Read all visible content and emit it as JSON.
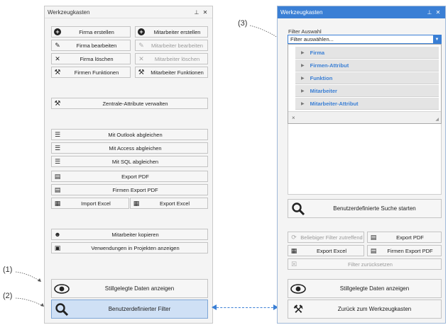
{
  "left_panel": {
    "title": "Werkzeugkasten",
    "pin_icon": "pin-icon",
    "close_icon": "close-icon",
    "buttons": {
      "firma_erstellen": "Firma erstellen",
      "mitarbeiter_erstellen": "Mitarbeiter erstellen",
      "firma_bearbeiten": "Firma bearbeiten",
      "mitarbeiter_bearbeiten": "Mitarbeiter bearbeiten",
      "firma_loeschen": "Firma löschen",
      "mitarbeiter_loeschen": "Mitarbeiter löschen",
      "firmen_funktionen": "Firmen Funktionen",
      "mitarbeiter_funktionen": "Mitarbeiter Funktionen",
      "zentrale_attribute": "Zentrale-Attribute verwalten",
      "outlook": "Mit Outlook abgleichen",
      "access": "Mit Access abgleichen",
      "sql": "Mit SQL abgleichen",
      "export_pdf": "Export PDF",
      "firmen_export_pdf": "Firmen Export PDF",
      "import_excel": "Import Excel",
      "export_excel": "Export Excel",
      "mitarbeiter_kopieren": "Mitarbeiter kopieren",
      "verwendungen": "Verwendungen in Projekten anzeigen",
      "stillgelegte": "Stillgelegte Daten anzeigen",
      "benutzerdefinierter_filter": "Benutzerdefinierter Filter"
    }
  },
  "right_panel": {
    "title": "Werkzeugkasten",
    "filter_label": "Filter Auswahl",
    "filter_placeholder": "Filter auswählen...",
    "filter_options": [
      "Firma",
      "Firmen-Attribut",
      "Funktion",
      "Mitarbeiter",
      "Mitarbeiter-Attribut"
    ],
    "clear_glyph": "×",
    "buttons": {
      "suche_starten": "Benutzerdefinierte Suche starten",
      "beliebiger_filter": "Beliebiger Filter zutreffend",
      "export_pdf": "Export PDF",
      "export_excel": "Export Excel",
      "firmen_export_pdf": "Firmen Export PDF",
      "filter_zuruecksetzen": "Filter zurücksetzen",
      "stillgelegte": "Stillgelegte Daten anzeigen",
      "zurueck": "Zurück zum Werkzeugkasten"
    }
  },
  "callouts": {
    "c1": "(1)",
    "c2": "(2)",
    "c3": "(3)"
  },
  "colors": {
    "accent": "#3a7fd5",
    "selected_bg": "#cfe0f5",
    "option_text": "#3a7fd5"
  }
}
